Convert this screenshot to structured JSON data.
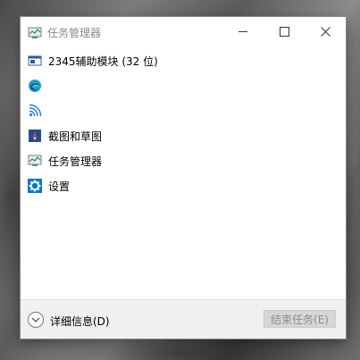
{
  "window": {
    "title": "任务管理器",
    "title_icon": "task-manager-icon"
  },
  "controls": {
    "minimize": "minimize",
    "maximize": "maximize",
    "close": "close"
  },
  "apps": [
    {
      "label": "2345辅助模块 (32 位)",
      "icon": "2345-module-icon"
    },
    {
      "label": "",
      "icon": "edge-icon"
    },
    {
      "label": "",
      "icon": "wifi-broadcast-icon"
    },
    {
      "label": "截图和草图",
      "icon": "snip-sketch-icon"
    },
    {
      "label": "任务管理器",
      "icon": "task-manager-icon"
    },
    {
      "label": "设置",
      "icon": "settings-gear-icon"
    }
  ],
  "footer": {
    "details_label": "详细信息(D)",
    "end_task_label": "结束任务(E)"
  },
  "colors": {
    "accent": "#0078d7",
    "disabled_button_bg": "#d6d6d6",
    "disabled_text": "#8e8e8e"
  }
}
